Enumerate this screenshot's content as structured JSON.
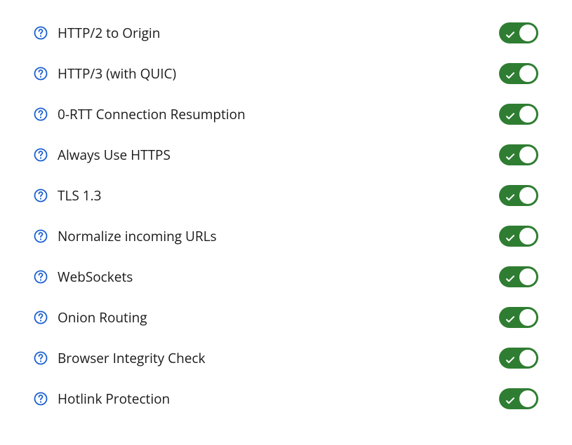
{
  "settings": [
    {
      "id": "http2-to-origin",
      "label": "HTTP/2 to Origin",
      "enabled": true
    },
    {
      "id": "http3-quic",
      "label": "HTTP/3 (with QUIC)",
      "enabled": true
    },
    {
      "id": "zero-rtt",
      "label": "0-RTT Connection Resumption",
      "enabled": true
    },
    {
      "id": "always-https",
      "label": "Always Use HTTPS",
      "enabled": true
    },
    {
      "id": "tls-13",
      "label": "TLS 1.3",
      "enabled": true
    },
    {
      "id": "normalize-urls",
      "label": "Normalize incoming URLs",
      "enabled": true
    },
    {
      "id": "websockets",
      "label": "WebSockets",
      "enabled": true
    },
    {
      "id": "onion-routing",
      "label": "Onion Routing",
      "enabled": true
    },
    {
      "id": "browser-integrity",
      "label": "Browser Integrity Check",
      "enabled": true
    },
    {
      "id": "hotlink-protection",
      "label": "Hotlink Protection",
      "enabled": true
    }
  ],
  "colors": {
    "toggle_on": "#2f7d32",
    "help_icon": "#1a5fd0"
  }
}
